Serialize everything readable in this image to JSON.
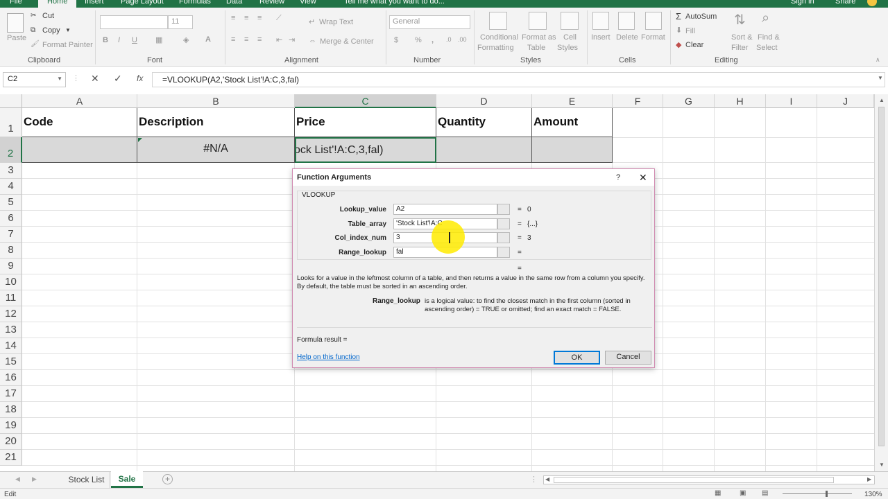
{
  "ribbon_tabs": [
    "File",
    "Home",
    "Insert",
    "Page Layout",
    "Formulas",
    "Data",
    "Review",
    "View"
  ],
  "tell_me": "Tell me what you want to do...",
  "account": {
    "sign_in": "Sign in",
    "share": "Share"
  },
  "clipboard": {
    "cut": "Cut",
    "copy": "Copy",
    "format_painter": "Format Painter",
    "paste": "Paste",
    "group": "Clipboard"
  },
  "font": {
    "size": "11",
    "group": "Font"
  },
  "alignment": {
    "wrap": "Wrap Text",
    "merge": "Merge & Center",
    "group": "Alignment"
  },
  "number": {
    "format": "General",
    "group": "Number"
  },
  "styles": {
    "conditional": "Conditional",
    "conditional2": "Formatting",
    "format_as": "Format as",
    "format_as2": "Table",
    "cell": "Cell",
    "cell2": "Styles",
    "group": "Styles"
  },
  "cells": {
    "insert": "Insert",
    "delete": "Delete",
    "format": "Format",
    "group": "Cells"
  },
  "editing": {
    "autosum": "AutoSum",
    "fill": "Fill",
    "clear": "Clear",
    "sort": "Sort &",
    "sort2": "Filter",
    "find": "Find &",
    "find2": "Select",
    "group": "Editing"
  },
  "formula_bar": {
    "name_box": "C2",
    "fx": "fx",
    "formula": "=VLOOKUP(A2,'Stock List'!A:C,3,fal)"
  },
  "columns": [
    "A",
    "B",
    "C",
    "D",
    "E",
    "F",
    "G",
    "H",
    "I",
    "J"
  ],
  "rows": [
    "1",
    "2",
    "3",
    "4",
    "5",
    "6",
    "7",
    "8",
    "9",
    "10",
    "11",
    "12",
    "13",
    "14",
    "15",
    "16",
    "17",
    "18",
    "19",
    "20",
    "21"
  ],
  "table": {
    "headers": [
      "Code",
      "Description",
      "Price",
      "Quantity",
      "Amount"
    ],
    "row2": {
      "b": "#N/A",
      "c": "ock List'!A:C,3,fal)"
    }
  },
  "dialog": {
    "title": "Function Arguments",
    "help_q": "?",
    "function": "VLOOKUP",
    "args": [
      {
        "label": "Lookup_value",
        "value": "A2",
        "result": "0"
      },
      {
        "label": "Table_array",
        "value": "'Stock List'!A:C",
        "result": "{...}"
      },
      {
        "label": "Col_index_num",
        "value": "3",
        "result": "3"
      },
      {
        "label": "Range_lookup",
        "value": "fal",
        "result": ""
      }
    ],
    "eq": "=",
    "description": "Looks for a value in the leftmost column of a table, and then returns a value in the same row from a column you specify. By default, the table must be sorted in an ascending order.",
    "arg_name": "Range_lookup",
    "arg_desc": "is a logical value: to find the closest match in the first column (sorted in ascending order) = TRUE or omitted; find an exact match = FALSE.",
    "formula_result": "Formula result =",
    "help_link": "Help on this function",
    "ok": "OK",
    "cancel": "Cancel"
  },
  "sheets": [
    "Stock List",
    "Sale"
  ],
  "status": {
    "mode": "Edit",
    "zoom": "130%"
  },
  "colors": {
    "excel_green": "#217346",
    "highlight": "#ffeb00"
  }
}
